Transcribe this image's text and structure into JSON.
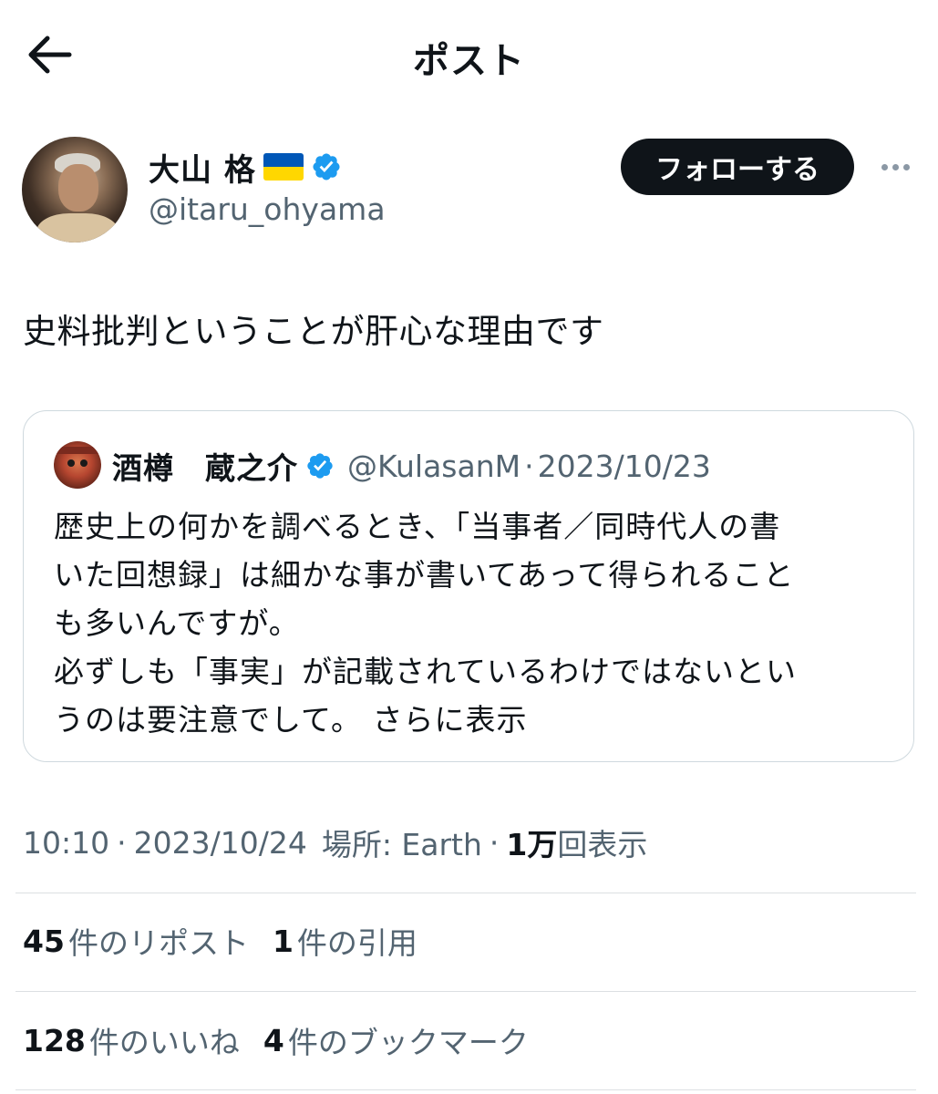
{
  "header": {
    "title": "ポスト",
    "back_icon": "arrow-left-icon"
  },
  "author": {
    "name": "大山 格",
    "handle": "@itaru_ohyama",
    "flag": "ukraine-flag",
    "verified_icon": "verified-badge-icon",
    "follow_label": "フォローする",
    "more_icon": "more-horizontal-icon"
  },
  "post": {
    "text": "史料批判ということが肝心な理由です"
  },
  "quote": {
    "name": "酒樽　蔵之介",
    "handle": "@KulasanM",
    "separator": "·",
    "date": "2023/10/23",
    "lines": [
      "歴史上の何かを調べるとき、「当事者／同時代人の書",
      "いた回想録」は細かな事が書いてあって得られること",
      "も多いんですが。",
      "必ずしも「事実」が記載されているわけではないとい",
      "うのは要注意でして。"
    ],
    "show_more": "さらに表示"
  },
  "meta": {
    "time": "10:10",
    "separator": "·",
    "date": "2023/10/24",
    "location": "場所: Earth",
    "views_num": "1万",
    "views_label": "回表示"
  },
  "stats": {
    "reposts_num": "45",
    "reposts_label": "件のリポスト",
    "quotes_num": "1",
    "quotes_label": "件の引用",
    "likes_num": "128",
    "likes_label": "件のいいね",
    "bookmarks_num": "4",
    "bookmarks_label": "件のブックマーク"
  },
  "colors": {
    "text": "#0f1419",
    "secondary": "#536471",
    "verified": "#1d9bf0",
    "flag_blue": "#0057b7",
    "flag_yellow": "#ffd700",
    "border": "#cfd9de"
  }
}
